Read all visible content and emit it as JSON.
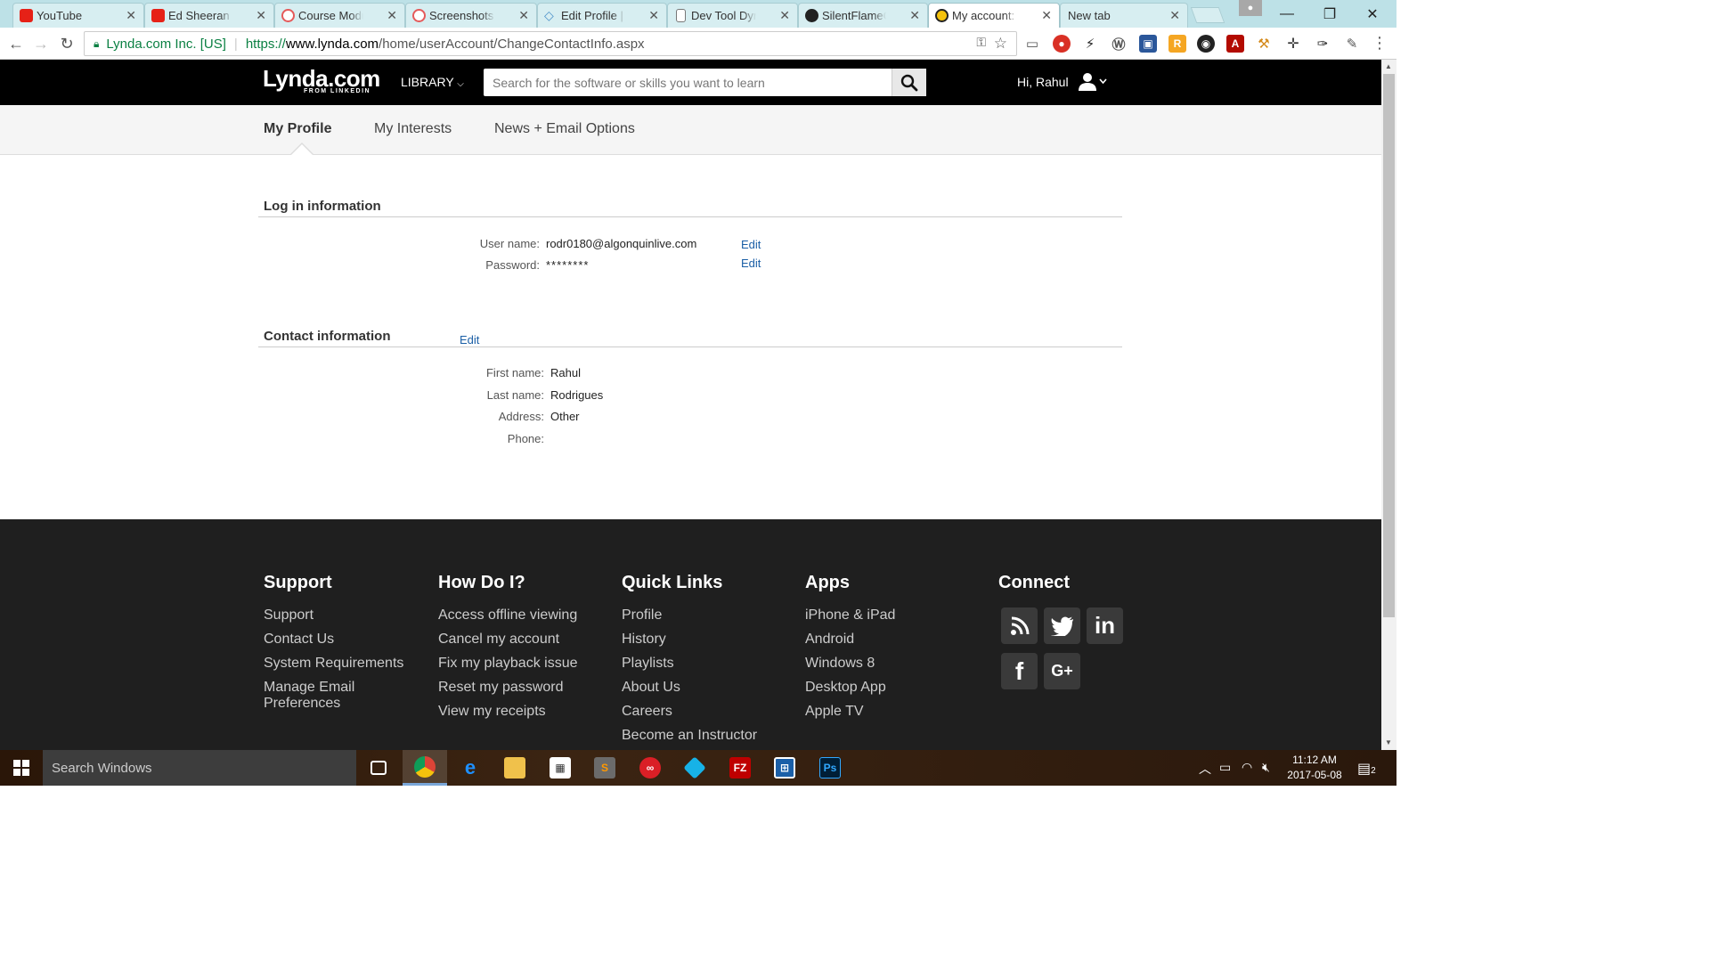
{
  "browser": {
    "tabs": [
      {
        "title": "YouTube",
        "favicon_color": "#e62117",
        "active": false
      },
      {
        "title": "Ed Sheeran - Ga",
        "favicon_color": "#e62117",
        "active": false
      },
      {
        "title": "Course Module",
        "favicon_color": "#e55a5a",
        "active": false
      },
      {
        "title": "Screenshots",
        "favicon_color": "#e55a5a",
        "active": false
      },
      {
        "title": "Edit Profile | Co",
        "favicon_color": "#4a90c9",
        "active": false
      },
      {
        "title": "Dev Tool Dynam",
        "favicon_color": "#888888",
        "active": false
      },
      {
        "title": "SilentFlameCR/",
        "favicon_color": "#222222",
        "active": false
      },
      {
        "title": "My account: My",
        "favicon_color": "#f4c20d",
        "active": true
      },
      {
        "title": "New tab",
        "favicon_color": "",
        "active": false
      }
    ],
    "secure_label": "Lynda.com Inc. [US]",
    "url_scheme": "https://",
    "url_host": "www.lynda.com",
    "url_path": "/home/userAccount/ChangeContactInfo.aspx"
  },
  "site": {
    "logo_text": "Lynda.com",
    "logo_sub": "FROM LINKEDIN",
    "library_label": "LIBRARY",
    "search_placeholder": "Search for the software or skills you want to learn",
    "greeting": "Hi, Rahul",
    "subnav": [
      "My Profile",
      "My Interests",
      "News + Email Options"
    ]
  },
  "login_info": {
    "title": "Log in information",
    "username_label": "User name:",
    "username_value": "rodr0180@algonquinlive.com",
    "password_label": "Password:",
    "password_value": "********",
    "edit_label": "Edit"
  },
  "contact_info": {
    "title": "Contact information",
    "edit_label": "Edit",
    "fields": [
      {
        "label": "First name:",
        "value": "Rahul"
      },
      {
        "label": "Last name:",
        "value": "Rodrigues"
      },
      {
        "label": "Address:",
        "value": "Other"
      },
      {
        "label": "Phone:",
        "value": ""
      }
    ]
  },
  "footer": {
    "support": {
      "title": "Support",
      "links": [
        "Support",
        "Contact Us",
        "System Requirements",
        "Manage Email Preferences"
      ]
    },
    "howdoi": {
      "title": "How Do I?",
      "links": [
        "Access offline viewing",
        "Cancel my account",
        "Fix my playback issue",
        "Reset my password",
        "View my receipts"
      ]
    },
    "quicklinks": {
      "title": "Quick Links",
      "links": [
        "Profile",
        "History",
        "Playlists",
        "About Us",
        "Careers",
        "Become an Instructor"
      ]
    },
    "apps": {
      "title": "Apps",
      "links": [
        "iPhone & iPad",
        "Android",
        "Windows 8",
        "Desktop App",
        "Apple TV"
      ]
    },
    "connect": {
      "title": "Connect",
      "icons": [
        "rss-icon",
        "twitter-icon",
        "linkedin-icon",
        "facebook-icon",
        "google-plus-icon"
      ]
    }
  },
  "taskbar": {
    "search_placeholder": "Search Windows",
    "time": "11:12 AM",
    "date": "2017-05-08",
    "notification_count": "2"
  }
}
